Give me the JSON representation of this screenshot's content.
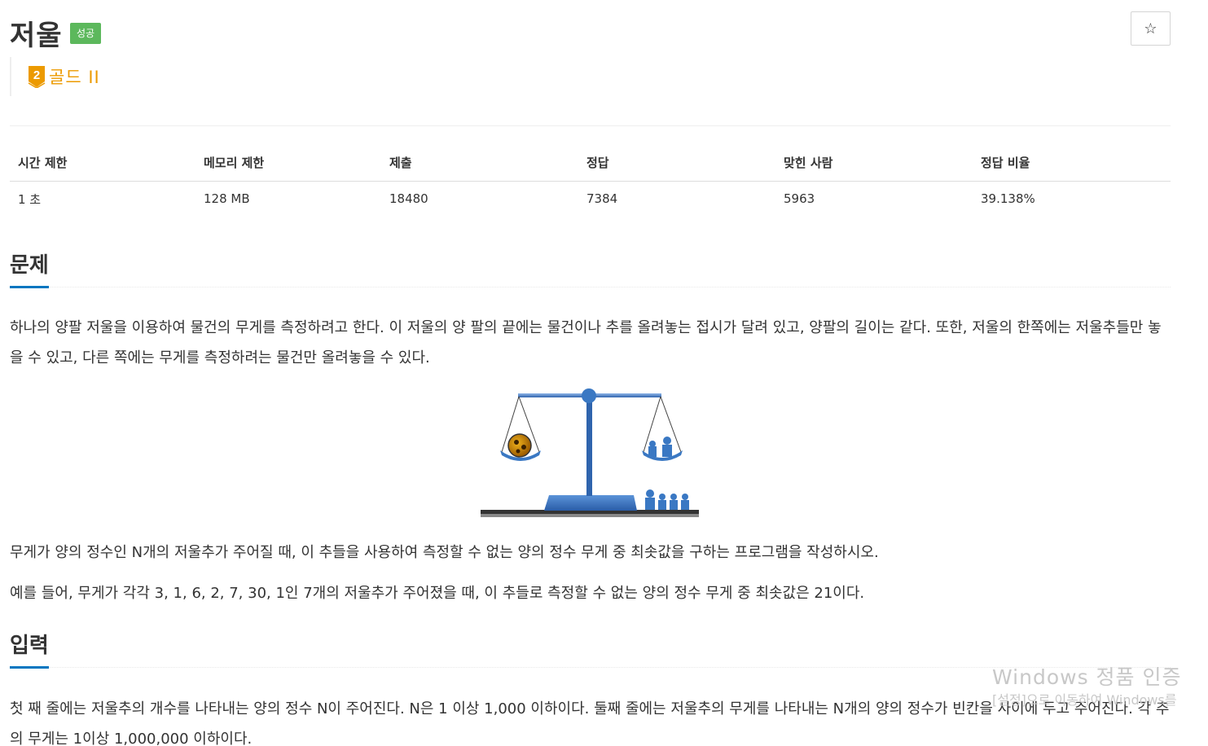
{
  "problem": {
    "title": "저울",
    "status_badge": "성공",
    "tier_label": "골드 II",
    "tier_number": "2",
    "star_icon": "star-icon"
  },
  "stats": {
    "headers": [
      "시간 제한",
      "메모리 제한",
      "제출",
      "정답",
      "맞힌 사람",
      "정답 비율"
    ],
    "values": [
      "1 초",
      "128 MB",
      "18480",
      "7384",
      "5963",
      "39.138%"
    ]
  },
  "sections": {
    "problem_title": "문제",
    "problem_p1": "하나의 양팔 저울을 이용하여 물건의 무게를 측정하려고 한다. 이 저울의 양 팔의 끝에는 물건이나 추를 올려놓는 접시가 달려 있고, 양팔의 길이는 같다. 또한, 저울의 한쪽에는 저울추들만 놓을 수 있고, 다른 쪽에는 무게를 측정하려는 물건만 올려놓을 수 있다.",
    "problem_p2": "무게가 양의 정수인 N개의 저울추가 주어질 때, 이 추들을 사용하여 측정할 수 없는 양의 정수 무게 중 최솟값을 구하는 프로그램을 작성하시오.",
    "problem_p3": "예를 들어, 무게가 각각 3, 1, 6, 2, 7, 30, 1인 7개의 저울추가 주어졌을 때, 이 추들로 측정할 수 없는 양의 정수 무게 중 최솟값은 21이다.",
    "input_title": "입력",
    "input_p1": "첫 째 줄에는 저울추의 개수를 나타내는 양의 정수 N이 주어진다. N은 1 이상 1,000 이하이다. 둘째 줄에는 저울추의 무게를 나타내는 N개의 양의 정수가 빈칸을 사이에 두고 주어진다. 각 추의 무게는 1이상 1,000,000 이하이다."
  },
  "watermark": {
    "main": "Windows 정품 인증",
    "sub": "[설정]으로 이동하여 Windows를"
  },
  "colors": {
    "success": "#5cb85c",
    "gold": "#ec9a00",
    "accent_blue": "#0076c0",
    "scale_blue": "#3a78c3"
  }
}
